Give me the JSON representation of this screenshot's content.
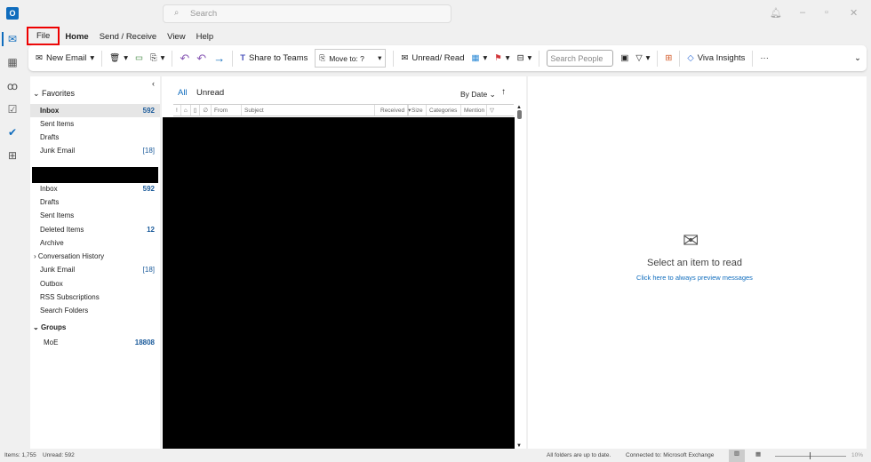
{
  "title_bar": {
    "search_placeholder": "Search"
  },
  "menu": {
    "tabs": [
      "File",
      "Home",
      "Send / Receive",
      "View",
      "Help"
    ],
    "highlighted": "File"
  },
  "ribbon": {
    "new_email": "New Email",
    "share_to_teams": "Share to Teams",
    "move_to": "Move to: ?",
    "unread_read": "Unread/ Read",
    "search_people_placeholder": "Search People",
    "viva_insights": "Viva Insights",
    "more": "···"
  },
  "favorites": {
    "header": "Favorites",
    "items": [
      {
        "label": "Inbox",
        "count": "592"
      },
      {
        "label": "Sent Items",
        "count": ""
      },
      {
        "label": "Drafts",
        "count": ""
      },
      {
        "label": "Junk Email",
        "count": "[18]"
      }
    ]
  },
  "mailbox": {
    "items": [
      {
        "label": "Inbox",
        "count": "592"
      },
      {
        "label": "Drafts",
        "count": ""
      },
      {
        "label": "Sent Items",
        "count": ""
      },
      {
        "label": "Deleted Items",
        "count": "12"
      },
      {
        "label": "Archive",
        "count": ""
      },
      {
        "label": "Conversation History",
        "count": ""
      },
      {
        "label": "Junk Email",
        "count": "[18]"
      },
      {
        "label": "Outbox",
        "count": ""
      },
      {
        "label": "RSS Subscriptions",
        "count": ""
      },
      {
        "label": "Search Folders",
        "count": ""
      }
    ]
  },
  "groups": {
    "header": "Groups",
    "items": [
      {
        "label": "MoE",
        "count": "18808"
      }
    ]
  },
  "message_list": {
    "filter_all": "All",
    "filter_unread": "Unread",
    "sort": "By Date",
    "columns": [
      "!",
      "",
      "",
      "",
      "From",
      "Subject",
      "Received",
      "Size",
      "Categories",
      "Mention"
    ]
  },
  "reading_pane": {
    "title": "Select an item to read",
    "link": "Click here to always preview messages"
  },
  "status_bar": {
    "items": "Items: 1,755",
    "unread": "Unread: 592",
    "sync": "All folders are up to date.",
    "connection": "Connected to: Microsoft Exchange",
    "zoom": "10%"
  },
  "colors": {
    "accent": "#0f6cbd",
    "file_highlight": "#e00000"
  }
}
